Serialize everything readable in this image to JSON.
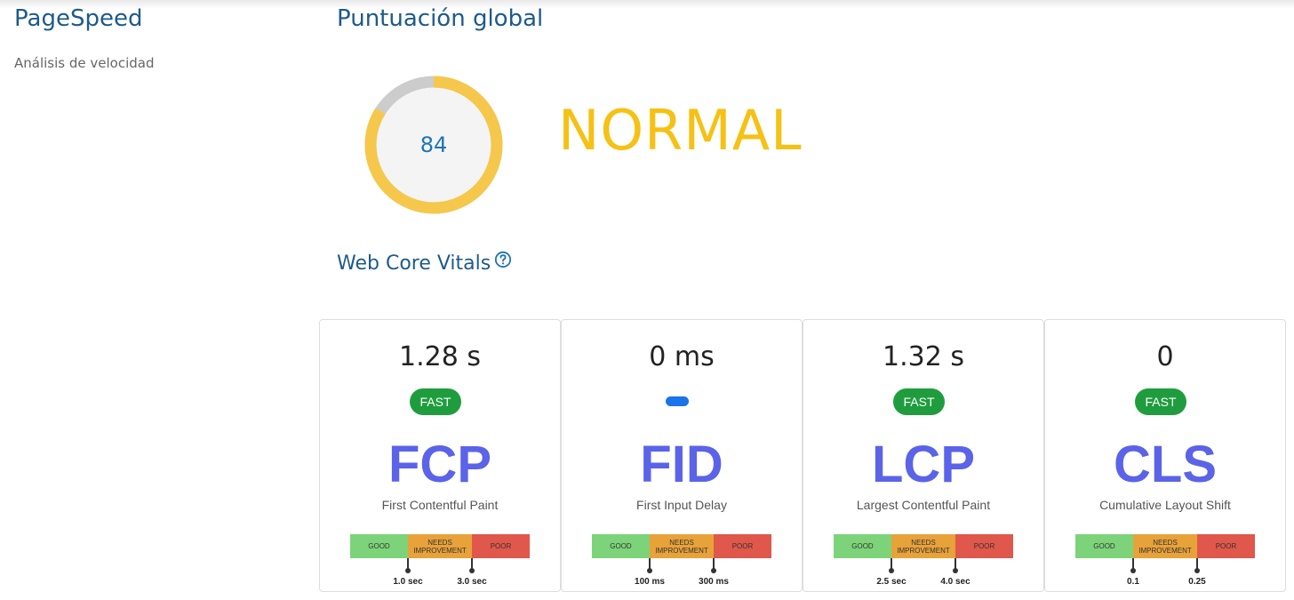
{
  "sidebar": {
    "title": "PageSpeed",
    "subtitle": "Análisis de velocidad"
  },
  "score_section": {
    "title": "Puntuación global",
    "score": "84",
    "score_fraction": 0.84,
    "status": "NORMAL",
    "ring_color": "#f5c84c",
    "ring_track_color": "#cccccc"
  },
  "vitals": {
    "title": "Web Core Vitals",
    "help_icon": "question-circle-icon",
    "bar_labels": {
      "good": "GOOD",
      "needs_line1": "NEEDS",
      "needs_line2": "IMPROVEMENT",
      "poor": "POOR"
    },
    "cards": [
      {
        "value": "1.28 s",
        "badge": "FAST",
        "abbr": "FCP",
        "name": "First Contentful Paint",
        "t1": "1.0 sec",
        "t2": "3.0 sec"
      },
      {
        "value": "0 ms",
        "badge": "",
        "abbr": "FID",
        "name": "First Input Delay",
        "t1": "100 ms",
        "t2": "300 ms"
      },
      {
        "value": "1.32 s",
        "badge": "FAST",
        "abbr": "LCP",
        "name": "Largest Contentful Paint",
        "t1": "2.5 sec",
        "t2": "4.0 sec"
      },
      {
        "value": "0",
        "badge": "FAST",
        "abbr": "CLS",
        "name": "Cumulative Layout Shift",
        "t1": "0.1",
        "t2": "0.25"
      }
    ]
  }
}
